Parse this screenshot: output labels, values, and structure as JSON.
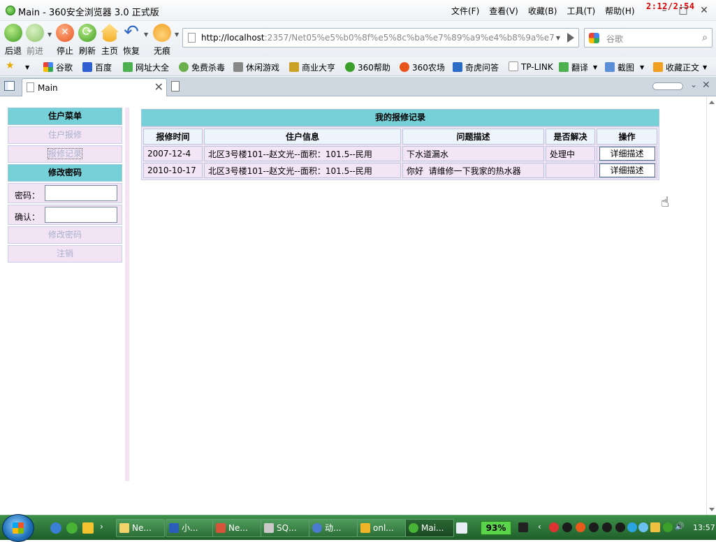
{
  "window": {
    "title": "Main - 360安全浏览器 3.0 正式版",
    "overlay_clock": "2:12/2:54",
    "menu": [
      "文件(F)",
      "查看(V)",
      "收藏(B)",
      "工具(T)",
      "帮助(H)"
    ]
  },
  "toolbar": {
    "back": "后退",
    "forward": "前进",
    "stop": "停止",
    "refresh": "刷新",
    "home": "主页",
    "restore": "恢复",
    "incognito": "无痕"
  },
  "address": {
    "host": "http://localhost",
    "path": ":2357/Net05%e5%b0%8f%e5%8c%ba%e7%89%a9%e4%b8%9a%e7"
  },
  "search": {
    "placeholder": "谷歌"
  },
  "favorites": [
    "谷歌",
    "百度",
    "网址大全",
    "免费杀毒",
    "休闲游戏",
    "商业大亨",
    "360帮助",
    "360农场",
    "奇虎问答",
    "TP-LINK",
    "翻译",
    "截图",
    "收藏正文"
  ],
  "tabs": [
    {
      "label": "Main"
    }
  ],
  "left_menu": {
    "resident_header": "住户菜单",
    "repair_request": "住户报修",
    "repair_records": "报修记录",
    "password_header": "修改密码",
    "password_label": "密码：",
    "confirm_label": "确认：",
    "change_password": "修改密码",
    "logout": "注销"
  },
  "records": {
    "caption": "我的报修记录",
    "columns": [
      "报修时间",
      "住户信息",
      "问题描述",
      "是否解决",
      "操作"
    ],
    "rows": [
      {
        "time": "2007-12-4",
        "resident": "北区3号楼101--赵文光--面积：101.5--民用",
        "issue": "下水道漏水",
        "status": "处理中",
        "action": "详细描述"
      },
      {
        "time": "2010-10-17",
        "resident": "北区3号楼101--赵文光--面积：101.5--民用",
        "issue": "你好  请维修一下我家的热水器",
        "status": "",
        "action": "详细描述"
      }
    ]
  },
  "taskbar": {
    "items": [
      "Ne...",
      "小...",
      "Ne...",
      "SQ...",
      "动...",
      "onl...",
      "Mai..."
    ],
    "battery": "93%",
    "clock": "13:57"
  },
  "colors": {
    "header_teal": "#76d0d8",
    "menu_pink": "#f2e4f4",
    "disabled_text": "#aab0cc",
    "overlay_red": "#dd0000"
  }
}
